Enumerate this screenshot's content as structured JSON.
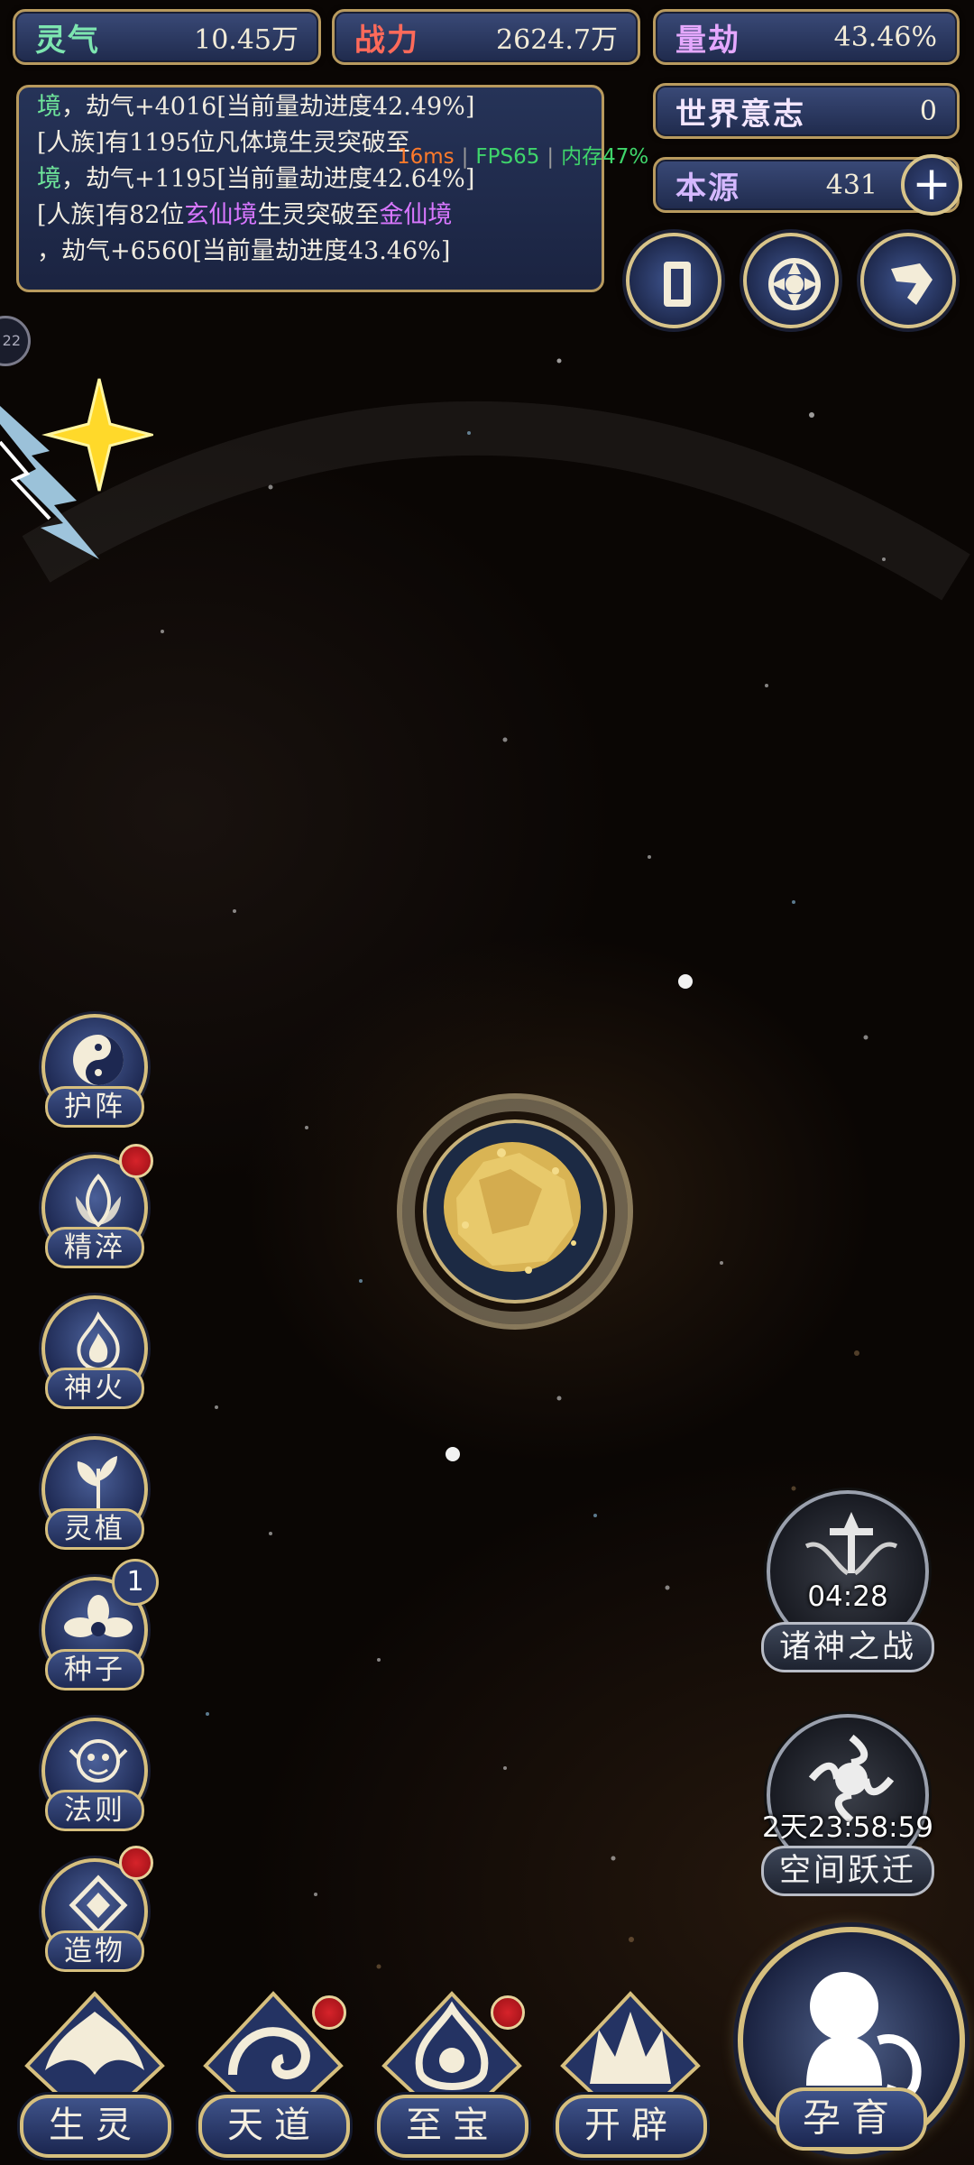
{
  "resources": {
    "lingqi": {
      "name": "灵气",
      "value": "10.45万"
    },
    "zhanli": {
      "name": "战力",
      "value": "2624.7万"
    },
    "liangjie": {
      "name": "量劫",
      "value": "43.46%"
    },
    "world_will": {
      "name": "世界意志",
      "value": "0"
    },
    "benyuan": {
      "name": "本源",
      "value": "431"
    }
  },
  "log": {
    "line1_a": "境",
    "line1_b": "，劫气+4016[当前量劫进度42.49%]",
    "line2": "[人族]有1195位凡体境生灵突破至",
    "line3_a": "境",
    "line3_b": "，劫气+1195[当前量劫进度42.64%]",
    "line4_a": "[人族]有82位",
    "line4_b": "玄仙境",
    "line4_c": "生灵突破至",
    "line4_d": "金仙境",
    "line5": "，劫气+6560[当前量劫进度43.46%]"
  },
  "debug": {
    "ms": "16ms",
    "fps": "FPS65",
    "mem": "内存47%"
  },
  "left_edge": {
    "label": "22"
  },
  "side_menu": [
    {
      "label": "护阵"
    },
    {
      "label": "精淬"
    },
    {
      "label": "神火"
    },
    {
      "label": "灵植"
    },
    {
      "label": "种子",
      "badge": "1"
    },
    {
      "label": "法则"
    },
    {
      "label": "造物"
    }
  ],
  "events": {
    "battle": {
      "label": "诸神之战",
      "timer": "04:28"
    },
    "warp": {
      "label": "空间跃迁",
      "timer": "2天23:58:59"
    }
  },
  "bottom_nav": [
    {
      "label": "生灵"
    },
    {
      "label": "天道"
    },
    {
      "label": "至宝"
    },
    {
      "label": "开辟"
    }
  ],
  "main_action": {
    "label": "孕育"
  },
  "colors": {
    "gold": "#d6bf7e",
    "panel": "#25345f",
    "badge_red": "#d6232a"
  }
}
